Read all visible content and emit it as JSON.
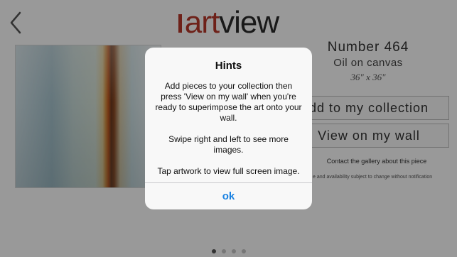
{
  "header": {
    "logo_art": "art",
    "logo_view": "view"
  },
  "artwork": {
    "title": "Number 464",
    "medium": "Oil on canvas",
    "size": "36\" x 36\""
  },
  "actions": {
    "add_collection": "dd to my collection",
    "view_wall": "View on my wall",
    "contact": "Contact the gallery about this piece",
    "disclaimer": "e and availability subject to change without notification"
  },
  "pager": {
    "count": 4,
    "active": 1
  },
  "dialog": {
    "title": "Hints",
    "paragraphs": [
      "Add pieces to your collection then press 'View on my wall' when you're ready to superimpose the art onto your wall.",
      "Swipe right and left to see more images.",
      "Tap artwork to view full screen image."
    ],
    "ok_label": "ok"
  },
  "colors": {
    "brand_red": "#b8382a",
    "link_blue": "#1a82e2"
  },
  "icons": {
    "back": "chevron-left-icon"
  }
}
